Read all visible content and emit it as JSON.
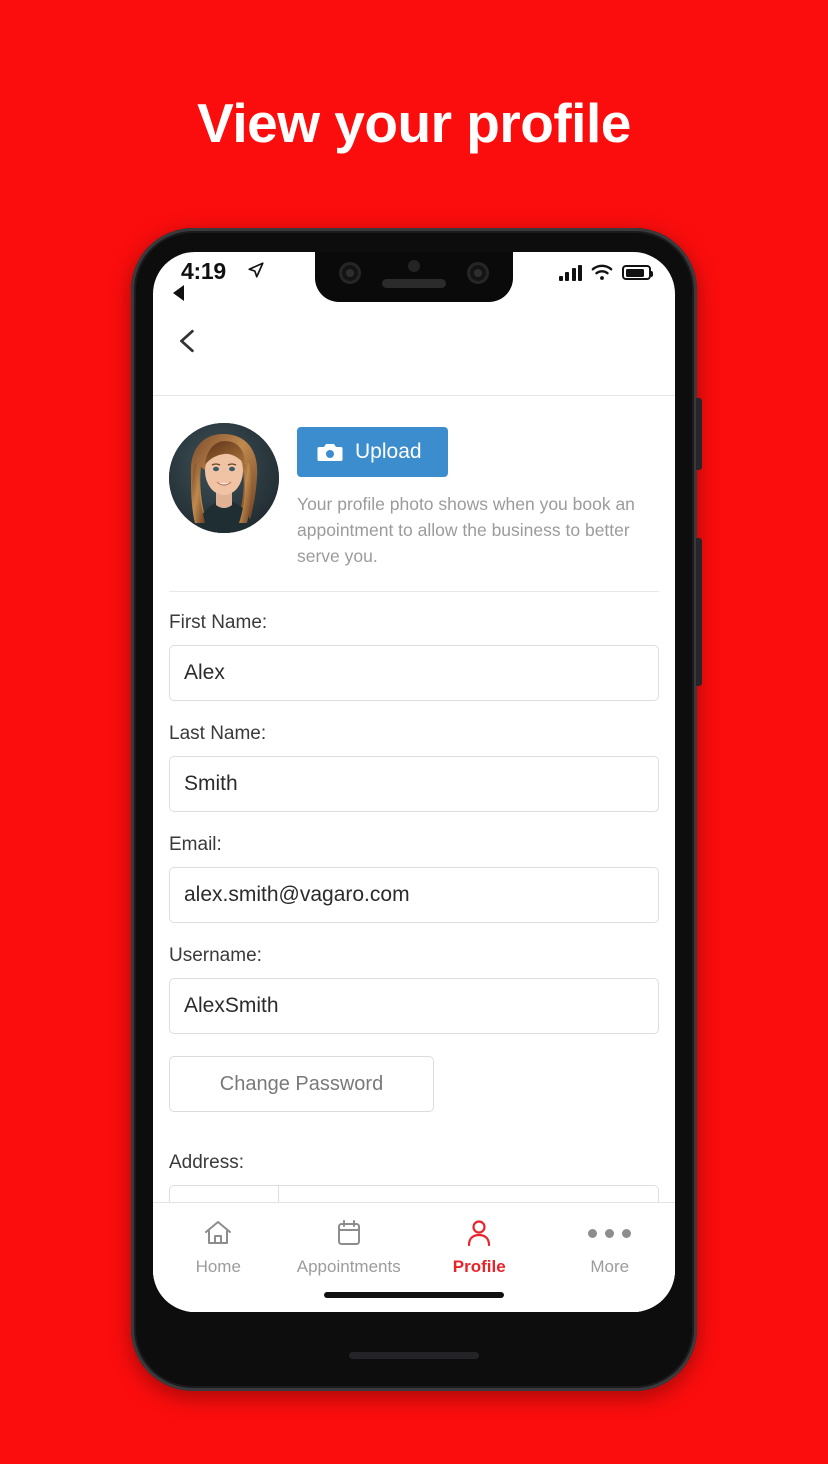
{
  "theme": {
    "background_red": "#fb0d0d",
    "accent_blue": "#3c8dcd",
    "active_tab_red": "#e8242a"
  },
  "headline": "View your profile",
  "status_bar": {
    "time": "4:19",
    "location_icon": "location-arrow-icon",
    "back_indicator_icon": "back-triangle-icon",
    "signal_icon": "cellular-bars-icon",
    "wifi_icon": "wifi-icon",
    "battery_icon": "battery-icon"
  },
  "app_bar": {
    "back_icon": "chevron-left-icon"
  },
  "photo_section": {
    "avatar_alt": "profile-photo",
    "upload_label": "Upload",
    "upload_icon": "camera-icon",
    "help_text": "Your profile photo shows when you book an appointment to allow the business to better serve you."
  },
  "form": {
    "fields": [
      {
        "label": "First Name:",
        "value": "Alex",
        "placeholder": "First Name",
        "name": "first-name"
      },
      {
        "label": "Last Name:",
        "value": "Smith",
        "placeholder": "Last Name",
        "name": "last-name"
      },
      {
        "label": "Email:",
        "value": "alex.smith@vagaro.com",
        "placeholder": "Email",
        "name": "email"
      },
      {
        "label": "Username:",
        "value": "AlexSmith",
        "placeholder": "Username",
        "name": "username"
      }
    ],
    "change_password_label": "Change Password",
    "address_label": "Address:",
    "address_prefix_value": "",
    "address_value": ""
  },
  "tab_bar": {
    "items": [
      {
        "label": "Home",
        "icon": "home-icon",
        "active": false
      },
      {
        "label": "Appointments",
        "icon": "calendar-icon",
        "active": false
      },
      {
        "label": "Profile",
        "icon": "person-icon",
        "active": true
      },
      {
        "label": "More",
        "icon": "ellipsis-icon",
        "active": false
      }
    ]
  }
}
